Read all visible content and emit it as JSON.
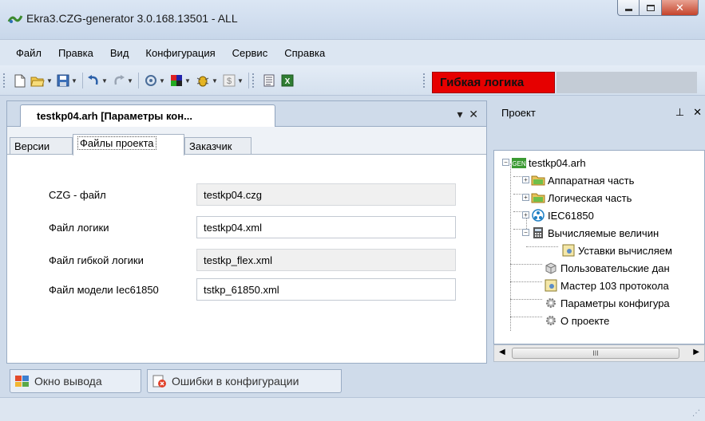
{
  "window": {
    "title": "Ekra3.CZG-generator 3.0.168.13501 - ALL",
    "icon": "app-icon",
    "controls": [
      "minimize-icon",
      "maximize-icon",
      "close-icon"
    ]
  },
  "menu": [
    "Файл",
    "Правка",
    "Вид",
    "Конфигурация",
    "Сервис",
    "Справка"
  ],
  "toolbar": {
    "buttons": [
      "new-icon",
      "open-icon",
      "save-icon",
      "undo-icon",
      "redo-icon",
      "refresh-icon",
      "color-palette-icon",
      "bug-icon",
      "dollar-icon",
      "doc-icon",
      "excel-icon"
    ],
    "flex_logic_label": "Гибкая логика",
    "flex_logic_color": "#e60000"
  },
  "document": {
    "tab_title": "testkp04.arh [Параметры кон...",
    "tabs": [
      "Версии",
      "Файлы проекта",
      "Заказчик"
    ],
    "active_tab": "Файлы проекта",
    "fields": [
      {
        "label": "CZG - файл",
        "value": "testkp04.czg"
      },
      {
        "label": "Файл логики",
        "value": "testkp04.xml"
      },
      {
        "label": "Файл гибкой логики",
        "value": "testkp_flex.xml"
      },
      {
        "label": "Файл модели Iec61850",
        "value": "tstkp_61850.xml"
      }
    ]
  },
  "project": {
    "header": "Проект",
    "tree": [
      {
        "label": "testkp04.arh",
        "icon": "project-icon"
      },
      {
        "label": "Аппаратная часть",
        "icon": "folder-icon"
      },
      {
        "label": "Логическая часть",
        "icon": "folder-icon"
      },
      {
        "label": "IEC61850",
        "icon": "network-icon"
      },
      {
        "label": "Вычисляемые величин",
        "icon": "calculator-icon"
      },
      {
        "label": "Уставки вычисляем",
        "icon": "settings-doc-icon"
      },
      {
        "label": "Пользовательские дан",
        "icon": "box-icon"
      },
      {
        "label": "Мастер 103 протокола",
        "icon": "settings-doc-icon"
      },
      {
        "label": "Параметры конфигура",
        "icon": "gear-icon"
      },
      {
        "label": "О проекте",
        "icon": "gear-icon"
      }
    ],
    "scroll_mark": "III"
  },
  "bottom_tabs": [
    {
      "label": "Окно вывода",
      "icon": "output-window-icon"
    },
    {
      "label": "Ошибки в конфигурации",
      "icon": "error-icon"
    }
  ]
}
